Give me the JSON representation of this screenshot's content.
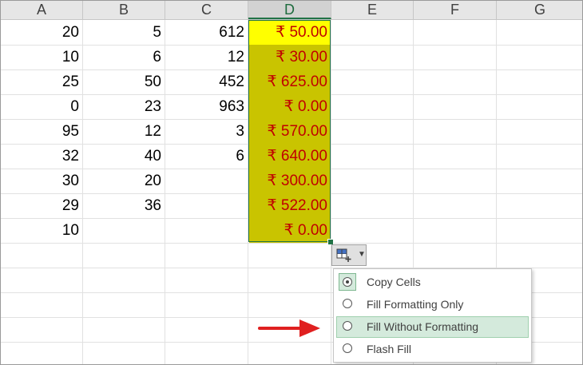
{
  "columns": [
    "A",
    "B",
    "C",
    "D",
    "E",
    "F",
    "G"
  ],
  "selected_column": "D",
  "rows": [
    {
      "a": "20",
      "b": "5",
      "c": "612",
      "d": "₹ 50.00"
    },
    {
      "a": "10",
      "b": "6",
      "c": "12",
      "d": "₹ 30.00"
    },
    {
      "a": "25",
      "b": "50",
      "c": "452",
      "d": "₹ 625.00"
    },
    {
      "a": "0",
      "b": "23",
      "c": "963",
      "d": "₹ 0.00"
    },
    {
      "a": "95",
      "b": "12",
      "c": "3",
      "d": "₹ 570.00"
    },
    {
      "a": "32",
      "b": "40",
      "c": "6",
      "d": "₹ 640.00"
    },
    {
      "a": "30",
      "b": "20",
      "c": "",
      "d": "₹ 300.00"
    },
    {
      "a": "29",
      "b": "36",
      "c": "",
      "d": "₹ 522.00"
    },
    {
      "a": "10",
      "b": "",
      "c": "",
      "d": "₹ 0.00"
    }
  ],
  "autofill_options": {
    "button_icon": "autofill-options-icon",
    "items": [
      {
        "label": "Copy Cells",
        "checked": true
      },
      {
        "label": "Fill Formatting Only",
        "checked": false
      },
      {
        "label": "Fill Without Formatting",
        "checked": false,
        "highlighted": true
      },
      {
        "label": "Flash Fill",
        "checked": false
      }
    ]
  },
  "colors": {
    "header_bg": "#e6e6e6",
    "selected_header_bg": "#d2d2d2",
    "selection_border": "#217346",
    "first_cell_fill": "#ffff00",
    "cell_fill": "#c9c400",
    "currency_text": "#c00000",
    "arrow": "#e02020",
    "menu_highlight": "#d4eadc"
  }
}
